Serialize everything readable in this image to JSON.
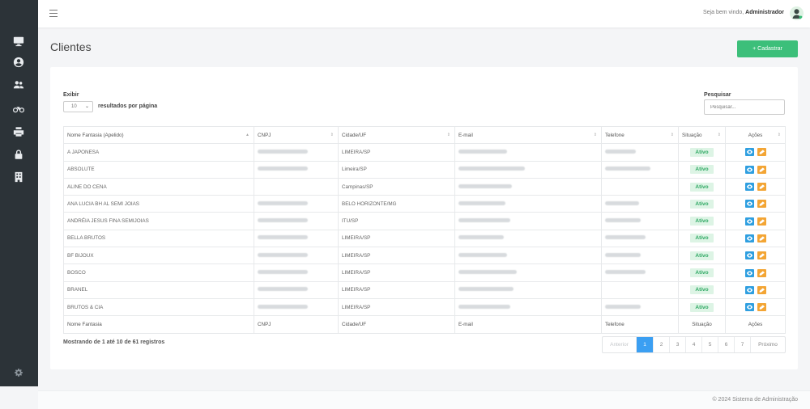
{
  "header": {
    "welcome_prefix": "Seja bem vindo,",
    "user_name": "Administrador"
  },
  "sidebar": {
    "items": [
      {
        "icon": "monitor-icon"
      },
      {
        "icon": "user-circle-icon"
      },
      {
        "icon": "users-icon"
      },
      {
        "icon": "motorcycle-icon"
      },
      {
        "icon": "printer-icon"
      },
      {
        "icon": "lock-icon"
      },
      {
        "icon": "building-icon"
      }
    ],
    "footer_icon": "gear-icon"
  },
  "page": {
    "title": "Clientes",
    "add_button": "+ Cadastrar"
  },
  "controls": {
    "length_label": "Exibir",
    "length_value": "10",
    "length_suffix": "resultados por página",
    "search_label": "Pesquisar",
    "search_placeholder": "Pesquisar..."
  },
  "table": {
    "columns": [
      "Nome Fantasia (Apelido)",
      "CNPJ",
      "Cidade/UF",
      "E-mail",
      "Telefone",
      "Situação",
      "Ações"
    ],
    "footer_columns": [
      "Nome Fantasia",
      "CNPJ",
      "Cidade/UF",
      "E-mail",
      "Telefone",
      "Situação",
      "Ações"
    ],
    "rows": [
      {
        "name": "A JAPONESA",
        "city": "LIMEIRA/SP",
        "status": "Ativo"
      },
      {
        "name": "ABSOLUTE",
        "city": "Limeira/SP",
        "status": "Ativo"
      },
      {
        "name": "ALINE DO CENA",
        "city": "Campinas/SP",
        "status": "Ativo"
      },
      {
        "name": "ANA LUCIA BH AL SEMI JOIAS",
        "city": "BELO HORIZONTE/MG",
        "status": "Ativo"
      },
      {
        "name": "ANDRÉIA JESUS FINA SEMIJOIAS",
        "city": "ITU/SP",
        "status": "Ativo"
      },
      {
        "name": "BELLA BRUTOS",
        "city": "LIMEIRA/SP",
        "status": "Ativo"
      },
      {
        "name": "BF BIJOUX",
        "city": "LIMEIRA/SP",
        "status": "Ativo"
      },
      {
        "name": "BOSCO",
        "city": "LIMEIRA/SP",
        "status": "Ativo"
      },
      {
        "name": "BRANEL",
        "city": "LIMEIRA/SP",
        "status": "Ativo"
      },
      {
        "name": "BRUTOS & CIA",
        "city": "LIMEIRA/SP",
        "status": "Ativo"
      }
    ]
  },
  "pagination": {
    "info": "Mostrando de 1 até 10 de 61 registros",
    "prev": "Anterior",
    "pages": [
      "1",
      "2",
      "3",
      "4",
      "5",
      "6",
      "7"
    ],
    "active": "1",
    "next": "Próximo"
  },
  "footer": {
    "text": "© 2024 Sistema de Administração"
  },
  "colors": {
    "primary_green": "#3cbf7a",
    "status_active_bg": "#ddf4e5",
    "view_button": "#2f9fe0",
    "edit_button": "#f3a534",
    "sidebar_bg": "#2c3338",
    "pager_active": "#3b9ff2"
  }
}
